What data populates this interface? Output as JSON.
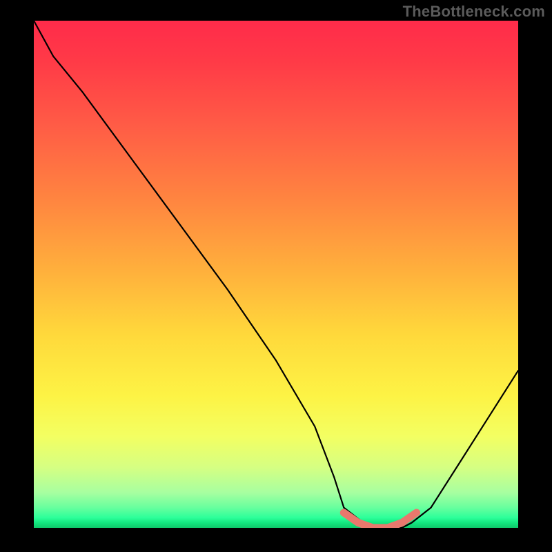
{
  "watermark": "TheBottleneck.com",
  "chart_data": {
    "type": "line",
    "title": "",
    "xlabel": "",
    "ylabel": "",
    "xlim": [
      0,
      100
    ],
    "ylim": [
      0,
      100
    ],
    "series": [
      {
        "name": "bottleneck-curve",
        "x": [
          0,
          4,
          10,
          20,
          30,
          40,
          50,
          58,
          62,
          64,
          68,
          72,
          76,
          78,
          82,
          88,
          94,
          100
        ],
        "y": [
          100,
          93,
          86,
          73,
          60,
          47,
          33,
          20,
          10,
          4,
          1,
          0,
          0,
          1,
          4,
          13,
          22,
          31
        ]
      }
    ],
    "highlight": {
      "name": "minimum-band",
      "x": [
        64,
        67,
        70,
        73,
        76,
        79
      ],
      "y": [
        3,
        1,
        0,
        0,
        1,
        3
      ],
      "color": "#e9786d"
    },
    "gradient_stops": [
      {
        "pos": 0.0,
        "color": "#ff2b4a"
      },
      {
        "pos": 0.5,
        "color": "#ffb23c"
      },
      {
        "pos": 0.8,
        "color": "#f3ff62"
      },
      {
        "pos": 1.0,
        "color": "#0fc96b"
      }
    ]
  }
}
